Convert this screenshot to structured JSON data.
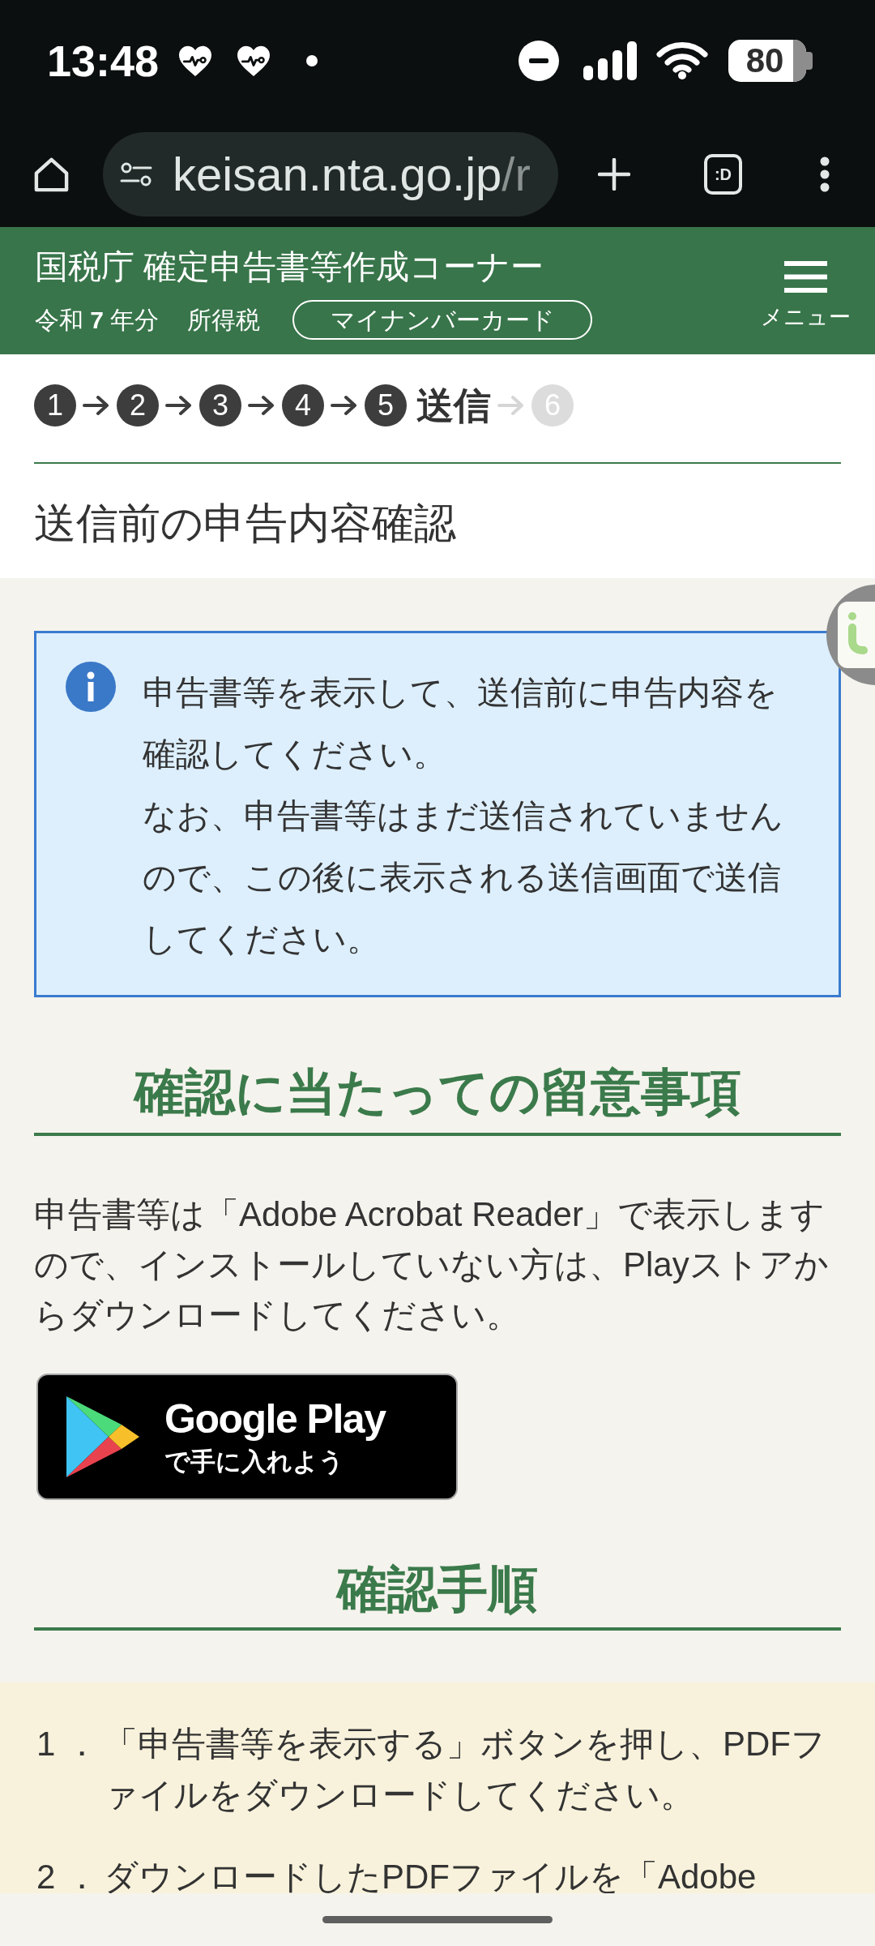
{
  "status_bar": {
    "time": "13:48",
    "battery": "80"
  },
  "browser": {
    "url_host": "keisan.nta.go.jp",
    "url_path": "/r",
    "tab_count": ":D"
  },
  "header": {
    "title": "国税庁 確定申告書等作成コーナー",
    "year": "令和 **7** 年分",
    "tax_type": "所得税",
    "login_method": "マイナンバーカード",
    "menu_label": "メニュー"
  },
  "steps": [
    {
      "number": "1",
      "kind": "done"
    },
    {
      "number": "2",
      "kind": "done"
    },
    {
      "number": "3",
      "kind": "done"
    },
    {
      "number": "4",
      "kind": "done"
    },
    {
      "number": "5",
      "label": "送信",
      "kind": "current"
    },
    {
      "number": "6",
      "kind": "upcoming"
    }
  ],
  "page_title": "送信前の申告内容確認",
  "notice": {
    "paragraphs": [
      "申告書等を表示して、送信前に申告内容を確認してください。",
      "なお、申告書等はまだ送信されていませんので、この後に表示される送信画面で送信してください。"
    ]
  },
  "sections": [
    {
      "heading": "確認に当たっての留意事項",
      "paragraphs": [
        "申告書等は「Adobe Acrobat Reader」で表示しますので、インストールしていない方は、Playストアからダウンロードしてください。"
      ],
      "store_badge": {
        "title": "Google Play",
        "subtitle": "で手に入れよう"
      }
    },
    {
      "heading": "確認手順",
      "list": [
        {
          "number": "1 ．",
          "text": "「申告書等を表示する」ボタンを押し、PDFファイルをダウンロードしてください。"
        },
        {
          "number": "2 ．",
          "text": "ダウンロードしたPDFファイルを「Adobe"
        }
      ]
    }
  ]
}
